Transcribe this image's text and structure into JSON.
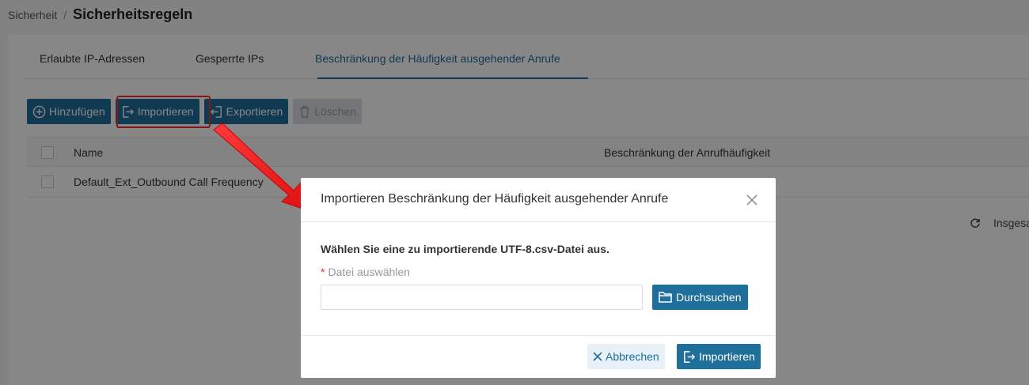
{
  "breadcrumb": {
    "parent": "Sicherheit",
    "separator": "/",
    "current": "Sicherheitsregeln"
  },
  "tabs": [
    {
      "label": "Erlaubte IP-Adressen"
    },
    {
      "label": "Gesperrte IPs"
    },
    {
      "label": "Beschränkung der Häufigkeit ausgehender Anrufe",
      "active": true
    }
  ],
  "toolbar": {
    "add_label": "Hinzufügen",
    "import_label": "Importieren",
    "export_label": "Exportieren",
    "delete_label": "Löschen"
  },
  "table": {
    "headers": {
      "name": "Name",
      "frequency": "Beschränkung der Anrufhäufigkeit"
    },
    "rows": [
      {
        "name": "Default_Ext_Outbound Call Frequency",
        "frequency": ""
      }
    ]
  },
  "pagination": {
    "total_label": "Insgesa"
  },
  "modal": {
    "title": "Importieren Beschränkung der Häufigkeit ausgehender Anrufe",
    "instruction": "Wählen Sie eine zu importierende UTF-8.csv-Datei aus.",
    "required_marker": "*",
    "field_label": "Datei auswählen",
    "file_value": "",
    "browse_label": "Durchsuchen",
    "cancel_label": "Abbrechen",
    "import_label": "Importieren"
  },
  "colors": {
    "primary": "#1f6f9c",
    "highlight": "#ff2a2a",
    "overlay": "rgba(0,0,0,0.47)"
  }
}
